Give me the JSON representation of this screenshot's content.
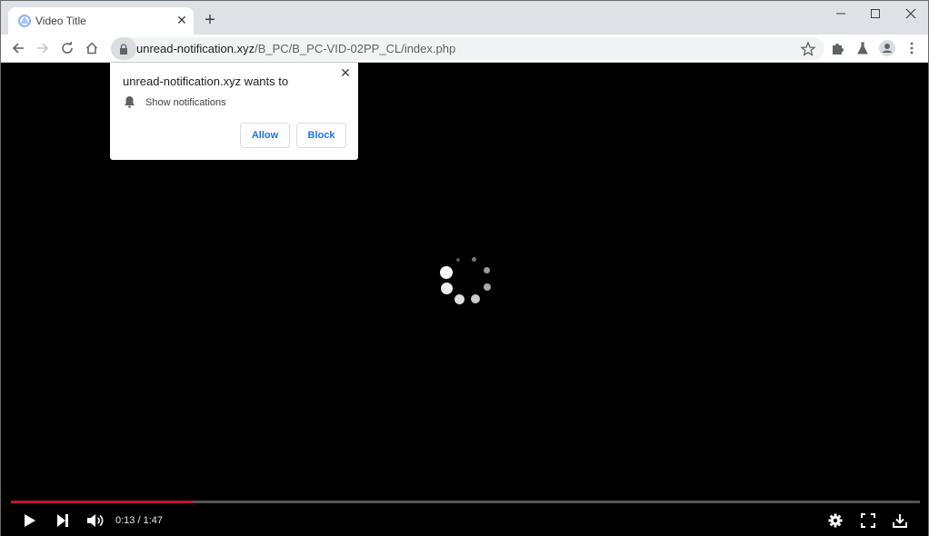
{
  "browser": {
    "tab": {
      "title": "Video Title",
      "close_glyph": "✕",
      "favicon": "site-favicon-icon"
    },
    "new_tab_glyph": "+",
    "window_controls": {
      "minimize": "minimize-icon",
      "maximize": "maximize-icon",
      "close": "close-icon"
    },
    "toolbar": {
      "back": "back-arrow-icon",
      "forward": "forward-arrow-icon",
      "reload": "reload-icon",
      "home": "home-icon",
      "url_domain": "unread-notification.xyz",
      "url_path": "/B_PC/B_PC-VID-02PP_CL/index.php",
      "bookmark": "star-icon",
      "extensions": "puzzle-icon",
      "labs": "flask-icon",
      "profile": "avatar-icon",
      "menu": "kebab-menu-icon"
    }
  },
  "permission_popup": {
    "title": "unread-notification.xyz wants to",
    "permission": "Show notifications",
    "allow_label": "Allow",
    "block_label": "Block",
    "close_glyph": "✕"
  },
  "player": {
    "current_time": "0:13",
    "duration": "1:47",
    "time_display": "0:13 / 1:47",
    "progress_fraction": 0.2,
    "colors": {
      "progress": "#c4112f",
      "track": "#555555"
    }
  }
}
